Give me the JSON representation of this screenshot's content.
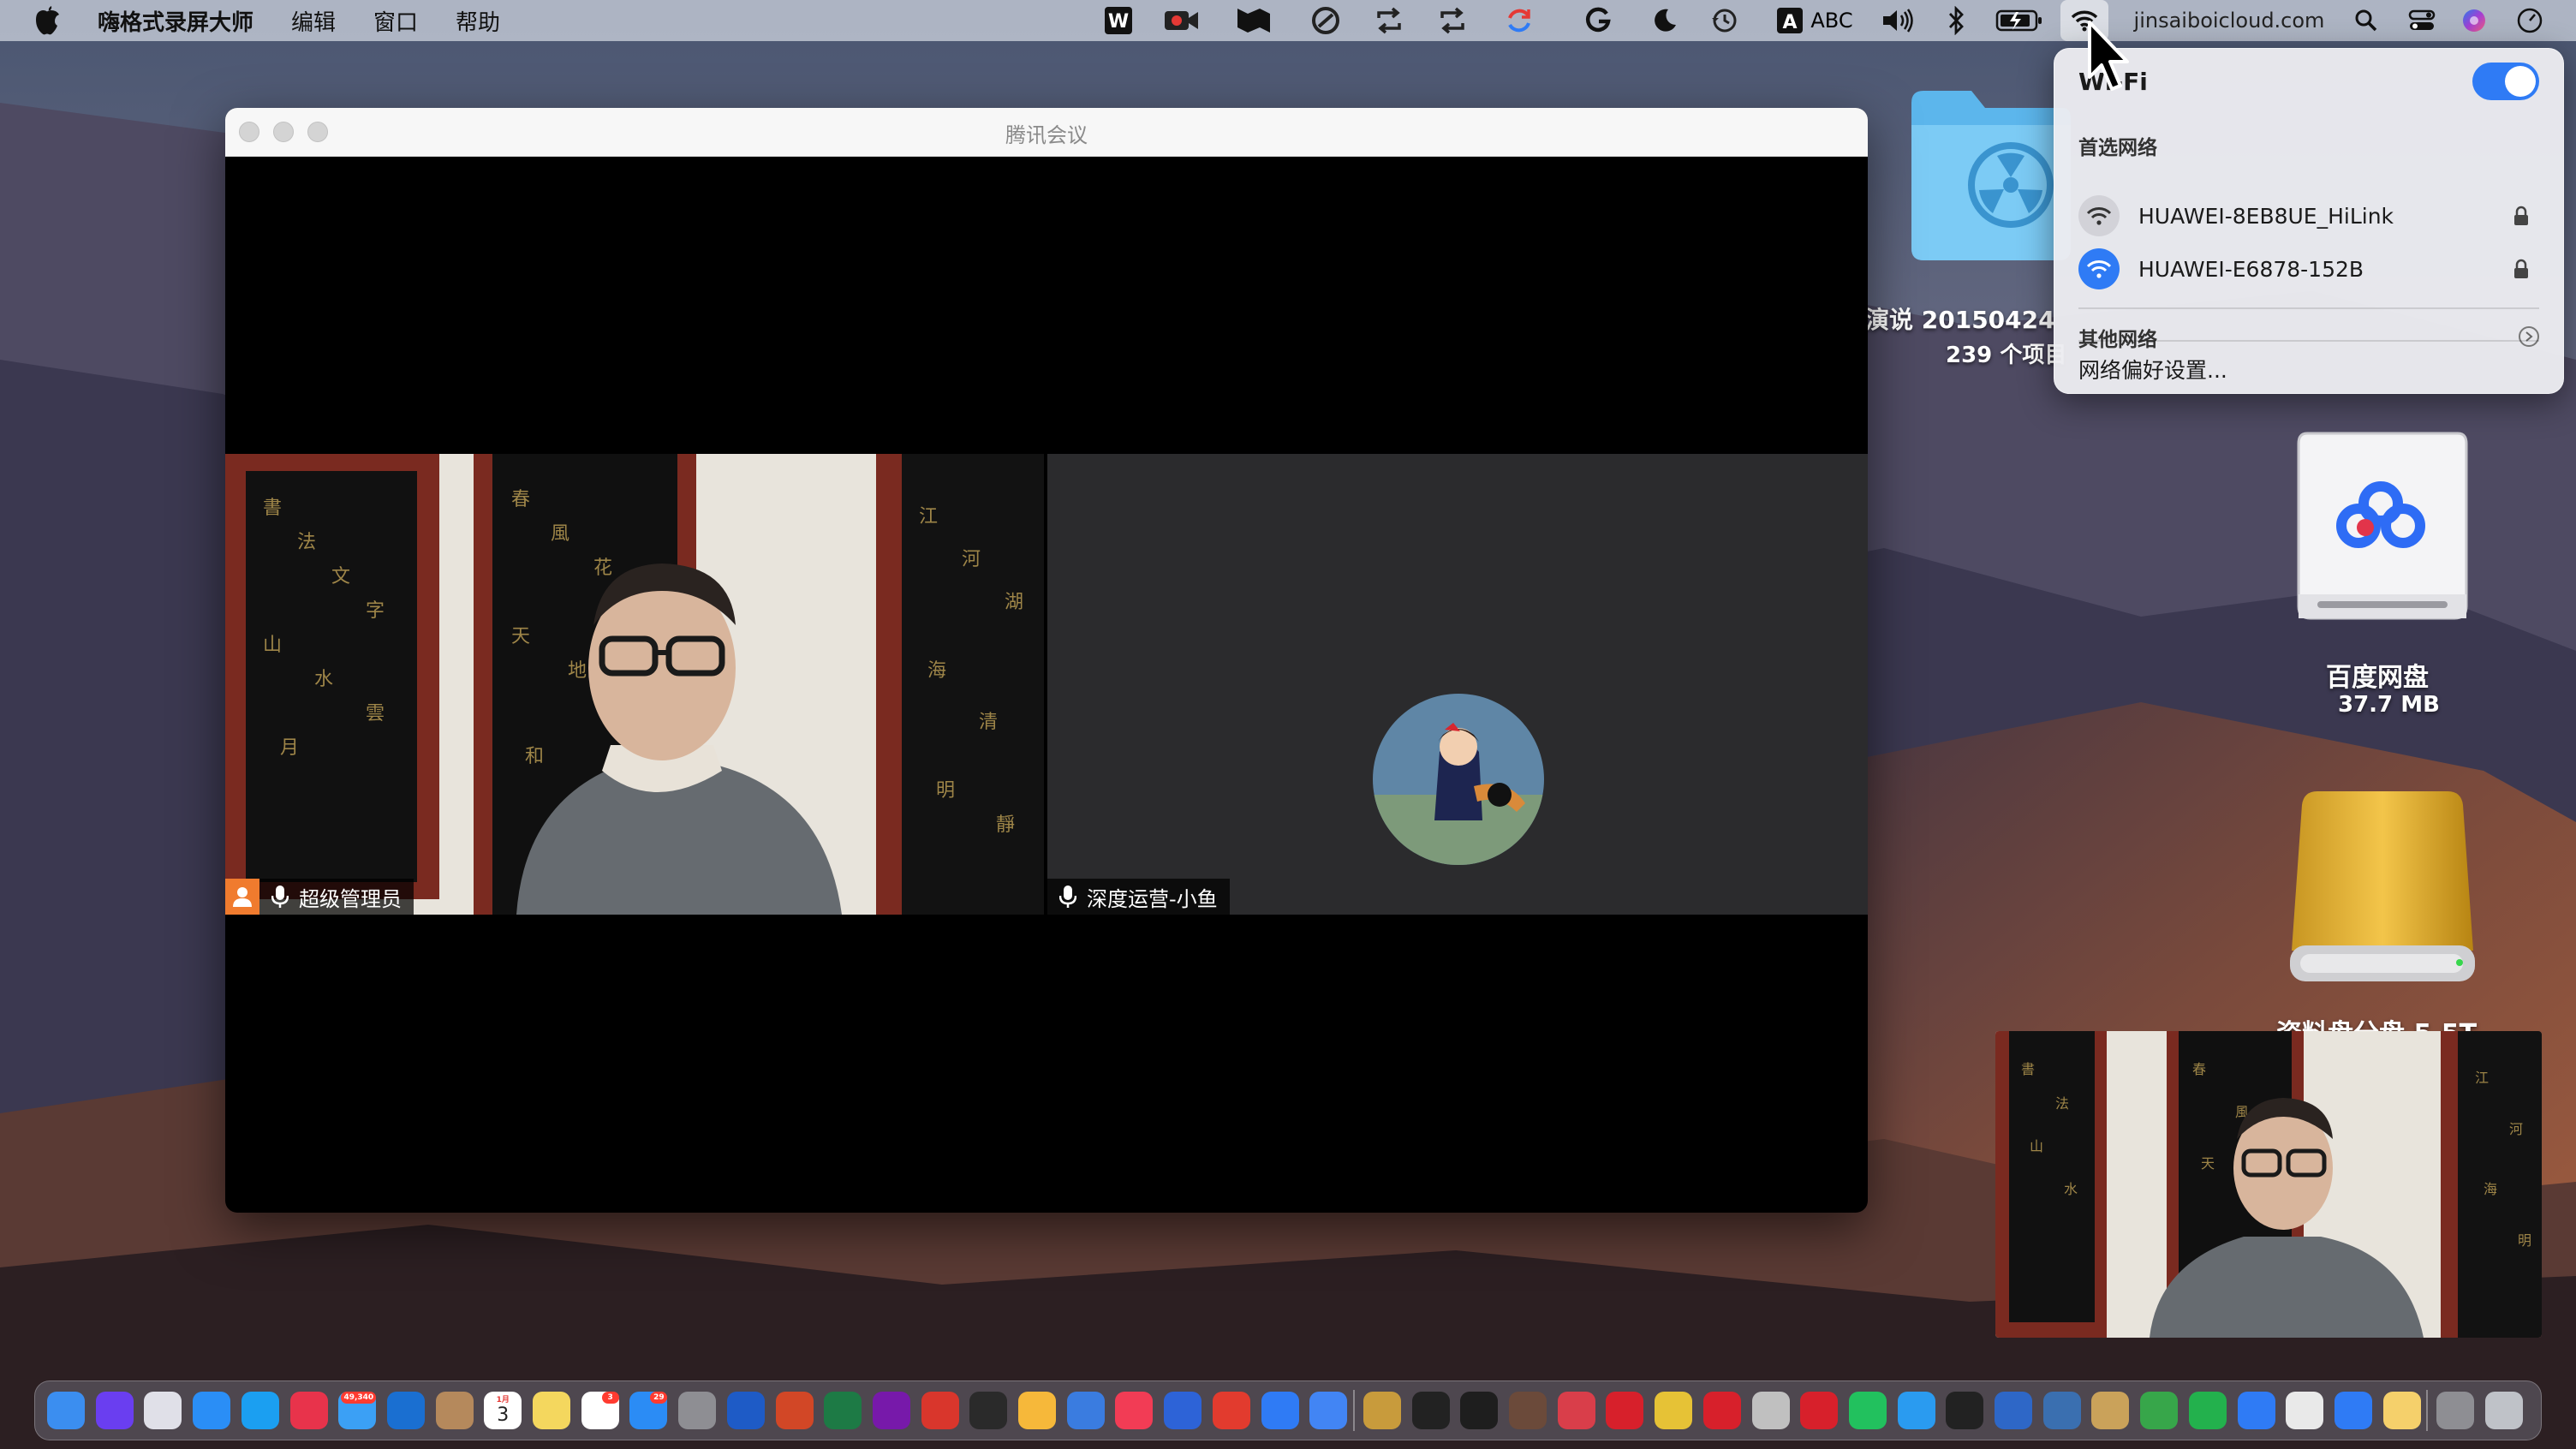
{
  "menubar": {
    "app_name": "嗨格式录屏大师",
    "menus": [
      "编辑",
      "窗口",
      "帮助"
    ],
    "input_method_label": "ABC",
    "account": "jinsaiboicloud.com"
  },
  "desktop": {
    "folder_label": "演说 20150424",
    "folder_count": "239 个项目",
    "baidu_drive_label": "百度网盘",
    "baidu_drive_size": "37.7 MB",
    "disk_label": "资料盘分盘 5.5T"
  },
  "meeting": {
    "window_title": "腾讯会议",
    "participants": [
      {
        "name": "超级管理员",
        "is_host": true
      },
      {
        "name": "深度运营-小鱼",
        "is_host": false
      }
    ]
  },
  "wifi_panel": {
    "title": "Wi-Fi",
    "enabled": true,
    "preferred_label": "首选网络",
    "networks": [
      {
        "name": "HUAWEI-8EB8UE_HiLink",
        "connected": false,
        "locked": true
      },
      {
        "name": "HUAWEI-E6878-152B",
        "connected": true,
        "locked": true
      }
    ],
    "other_label": "其他网络",
    "prefs_label": "网络偏好设置..."
  },
  "dock": {
    "badges": {
      "mail": "49,340",
      "calendar_day": "3",
      "calendar_month": "1月",
      "reminders": "3",
      "appstore": "29"
    },
    "apps": [
      "finder",
      "siri",
      "launchpad",
      "safari",
      "qq-browser",
      "app-g",
      "mail",
      "outlook",
      "contacts",
      "calendar",
      "notes",
      "reminders",
      "app-store",
      "system-preferences",
      "word",
      "powerpoint",
      "excel",
      "onenote",
      "pdf-expert",
      "quicktime",
      "photos",
      "preview",
      "music",
      "app-list",
      "app-red",
      "baidu-netdisk",
      "chrome",
      "keka",
      "typora",
      "terminal",
      "app-film",
      "app-atom",
      "app-pdf-red",
      "app-scissors",
      "pdf-app",
      "app-triangle",
      "wps-pdf",
      "wechat",
      "app-photo",
      "app-clock",
      "app-net",
      "app-lamp",
      "app-brush",
      "numbers",
      "app-green",
      "app-blue",
      "app-fox",
      "wps",
      "app-box",
      "file-manager",
      "trash"
    ],
    "colors": [
      "#3b8ef0",
      "#6a3ef0",
      "#e0e0e8",
      "#2a8ef6",
      "#1b9ff1",
      "#e8334b",
      "#3ba0f5",
      "#1a6fd1",
      "#b5895c",
      "#ffffff",
      "#f4d75e",
      "#ffffff",
      "#2b8cf5",
      "#8e8e93",
      "#1e5bc6",
      "#d24726",
      "#1d7a45",
      "#7719aa",
      "#d9362c",
      "#2a2a2a",
      "#f6b83a",
      "#3a7ce0",
      "#f23c55",
      "#2d63d7",
      "#e23b2e",
      "#2f7bf5",
      "#4285f4",
      "#c89b3c",
      "#222222",
      "#1e1e1e",
      "#6b4a3a",
      "#d93e4a",
      "#d7202b",
      "#e6c236",
      "#d7202b",
      "#c0c0c0",
      "#d7202b",
      "#22c15e",
      "#2a9bf0",
      "#222222",
      "#2e67c7",
      "#3a6fb0",
      "#caa25a",
      "#37a64a",
      "#23b14d",
      "#2f7bf5",
      "#e9e9e9",
      "#2f7bf5",
      "#f5d06b",
      "#8e8e93",
      "#bfc2c8"
    ]
  }
}
